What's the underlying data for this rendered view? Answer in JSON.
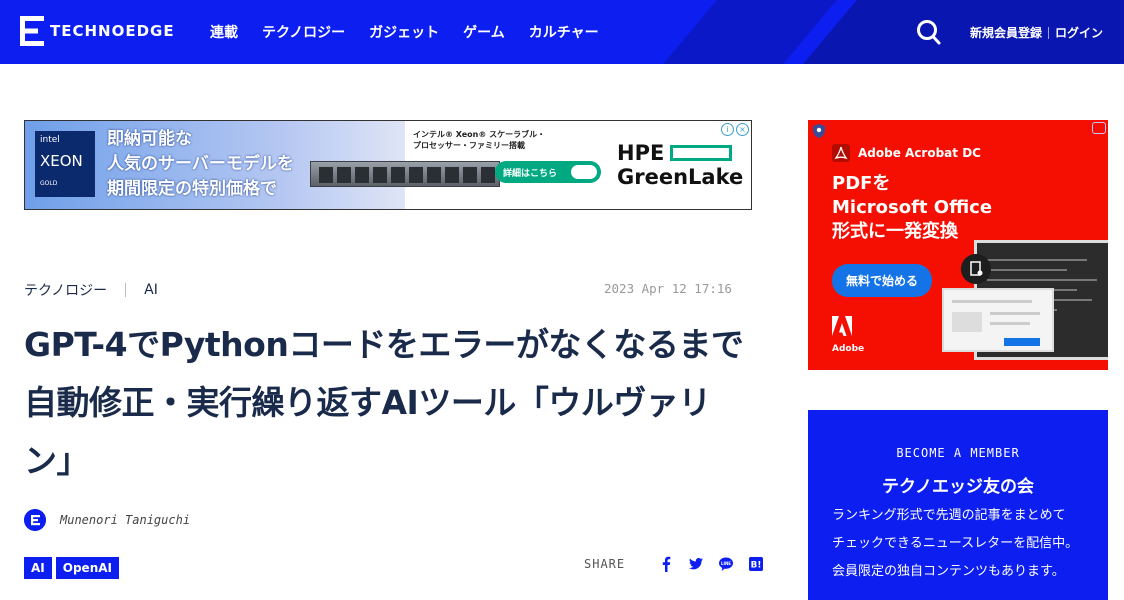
{
  "header": {
    "logo_text": "TECHNOEDGE",
    "nav": [
      "連載",
      "テクノロジー",
      "ガジェット",
      "ゲーム",
      "カルチャー"
    ],
    "register_label": "新規会員登録",
    "login_label": "ログイン"
  },
  "banner_ad": {
    "badge_brand": "intel",
    "badge_product": "XEON",
    "badge_tier": "GOLD",
    "headline": [
      "即納可能な",
      "人気のサーバーモデルを",
      "期間限定の特別価格で"
    ],
    "subtext": [
      "インテル® Xeon® スケーラブル・",
      "プロセッサー・ファミリー搭載"
    ],
    "cta": "詳細はこちら",
    "brand": [
      "HPE",
      "GreenLake"
    ]
  },
  "article": {
    "category": "テクノロジー",
    "subcategory": "AI",
    "date": "2023 Apr 12 17:16",
    "title": "GPT-4でPythonコードをエラーがなくなるまで自動修正・実行繰り返すAIツール「ウルヴァリン」",
    "author": "Munenori Taniguchi",
    "tags": [
      "AI",
      "OpenAI"
    ],
    "share_label": "SHARE"
  },
  "side_ad": {
    "brand_line": "Adobe Acrobat DC",
    "headline": [
      "PDFを",
      "Microsoft Office",
      "形式に一発変換"
    ],
    "cta": "無料で始める",
    "logo_text": "Adobe",
    "colors": {
      "bg": "#f40f02",
      "button": "#1473e6"
    }
  },
  "member_box": {
    "kicker": "BECOME A MEMBER",
    "title": "テクノエッジ友の会",
    "description": [
      "ランキング形式で先週の記事をまとめて",
      "チェックできるニュースレターを配信中。",
      "会員限定の独自コンテンツもあります。"
    ]
  },
  "colors": {
    "brand_blue": "#0c1ef0",
    "text": "#1a2a4a"
  }
}
